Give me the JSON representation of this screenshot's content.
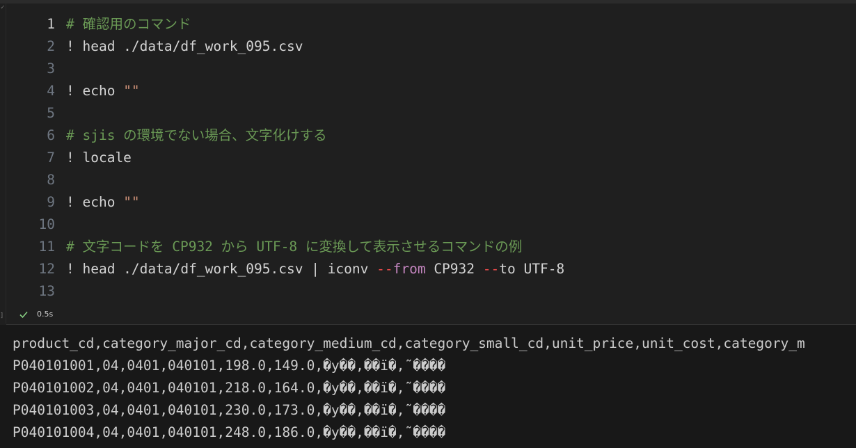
{
  "editor": {
    "active_line": 1,
    "lines": [
      {
        "num": "1",
        "segments": [
          {
            "cls": "c-comment",
            "text": "# 確認用のコマンド"
          }
        ]
      },
      {
        "num": "2",
        "segments": [
          {
            "cls": "c-plain",
            "text": "! head ./data/df_work_095.csv"
          }
        ]
      },
      {
        "num": "3",
        "segments": []
      },
      {
        "num": "4",
        "segments": [
          {
            "cls": "c-plain",
            "text": "! echo "
          },
          {
            "cls": "c-string",
            "text": "\"\""
          }
        ]
      },
      {
        "num": "5",
        "segments": []
      },
      {
        "num": "6",
        "segments": [
          {
            "cls": "c-comment",
            "text": "# sjis の環境でない場合、文字化けする"
          }
        ]
      },
      {
        "num": "7",
        "segments": [
          {
            "cls": "c-plain",
            "text": "! locale"
          }
        ]
      },
      {
        "num": "8",
        "segments": []
      },
      {
        "num": "9",
        "segments": [
          {
            "cls": "c-plain",
            "text": "! echo "
          },
          {
            "cls": "c-string",
            "text": "\"\""
          }
        ]
      },
      {
        "num": "10",
        "segments": []
      },
      {
        "num": "11",
        "segments": [
          {
            "cls": "c-comment",
            "text": "# 文字コードを CP932 から UTF-8 に変換して表示させるコマンドの例"
          }
        ]
      },
      {
        "num": "12",
        "segments": [
          {
            "cls": "c-plain",
            "text": "! head ./data/df_work_095.csv | iconv "
          },
          {
            "cls": "c-op",
            "text": "--"
          },
          {
            "cls": "c-kw",
            "text": "from"
          },
          {
            "cls": "c-plain",
            "text": " CP932 "
          },
          {
            "cls": "c-op",
            "text": "--"
          },
          {
            "cls": "c-plain",
            "text": "to UTF-8"
          }
        ]
      },
      {
        "num": "13",
        "segments": []
      }
    ]
  },
  "status": {
    "icon": "check-icon",
    "duration": "0.5s",
    "success_color": "#89d185"
  },
  "output": {
    "lines": [
      "product_cd,category_major_cd,category_medium_cd,category_small_cd,unit_price,unit_cost,category_m",
      "P040101001,04,0401,040101,198.0,149.0,�y��,��ï�,˜����",
      "P040101002,04,0401,040101,218.0,164.0,�y��,��ï�,˜����",
      "P040101003,04,0401,040101,230.0,173.0,�y��,��ï�,˜����",
      "P040101004,04,0401,040101,248.0,186.0,�y��,��ï�,˜����"
    ]
  }
}
